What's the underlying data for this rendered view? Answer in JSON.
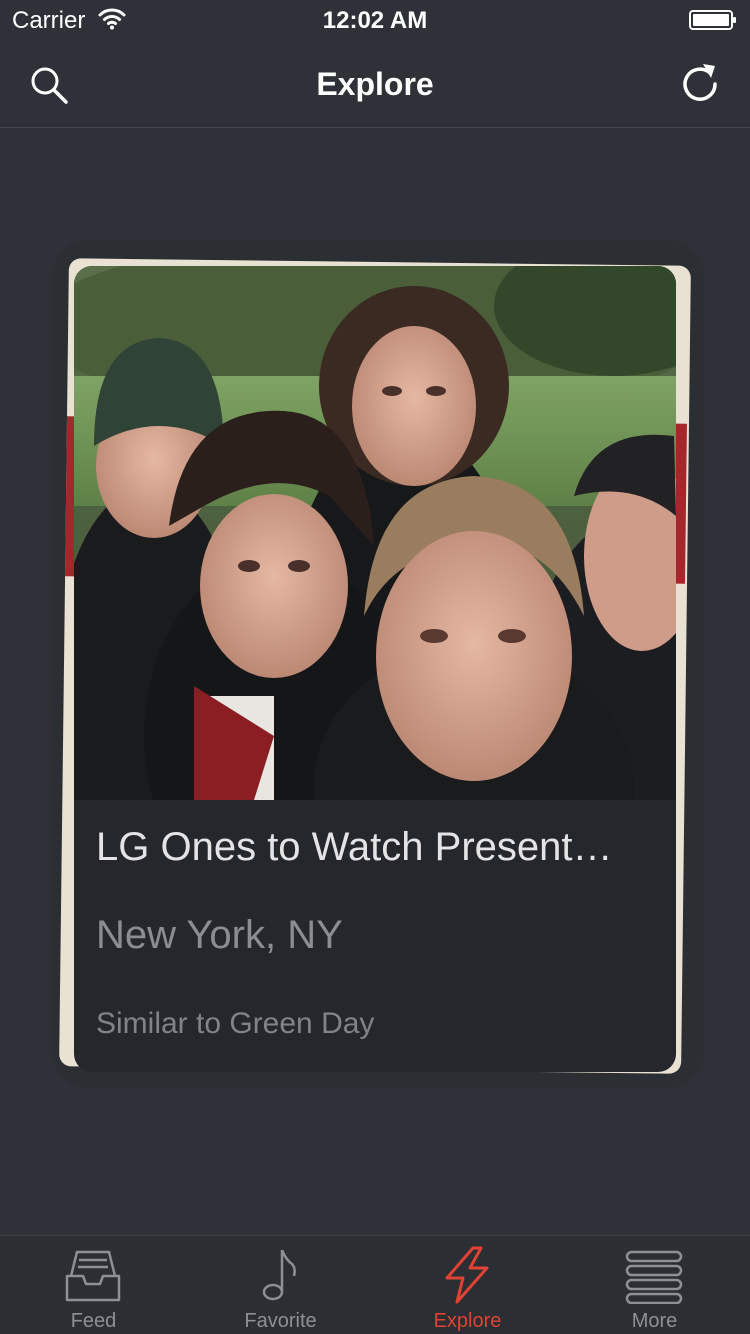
{
  "status_bar": {
    "carrier": "Carrier",
    "time": "12:02 AM"
  },
  "nav": {
    "title": "Explore",
    "left_icon": "search-icon",
    "right_icon": "refresh-icon"
  },
  "card": {
    "photo_icon": "band-photo",
    "title": "LG Ones to Watch Present…",
    "location": "New York, NY",
    "similar": "Similar to Green Day"
  },
  "tabs": [
    {
      "label": "Feed",
      "icon": "inbox-icon",
      "active": false
    },
    {
      "label": "Favorite",
      "icon": "music-note-icon",
      "active": false
    },
    {
      "label": "Explore",
      "icon": "lightning-icon",
      "active": true
    },
    {
      "label": "More",
      "icon": "menu-icon",
      "active": false
    }
  ],
  "colors": {
    "background": "#2e3137",
    "accent": "#e04233",
    "card": "#25272c",
    "tab_inactive": "#8d9096"
  }
}
